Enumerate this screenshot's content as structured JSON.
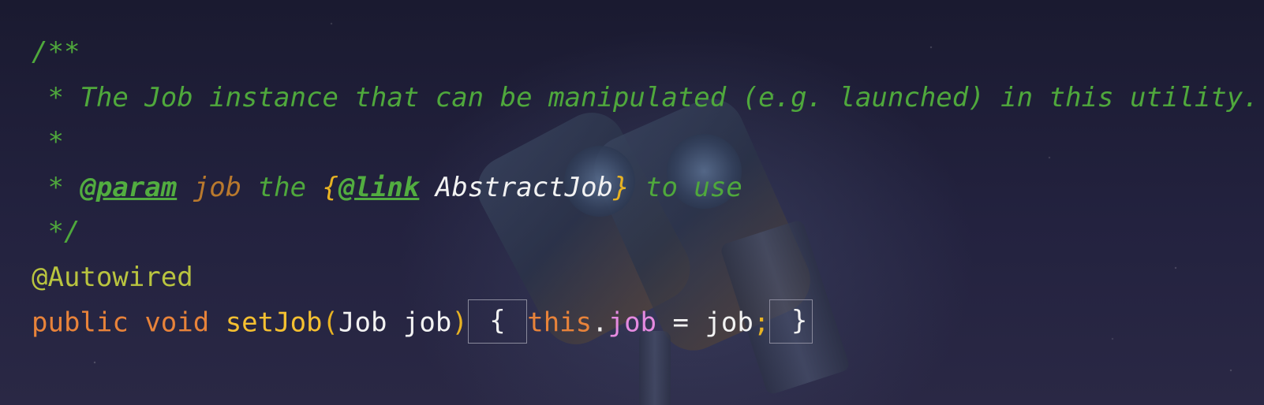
{
  "javadoc": {
    "open": "/**",
    "summary": " * The Job instance that can be manipulated (e.g. launched) in this utility.",
    "blank": " *",
    "param_prefix": " * ",
    "param_tag": "@param",
    "param_space": " ",
    "param_name": "job",
    "param_the": " the ",
    "link_open": "{",
    "link_tag": "@link",
    "link_space": " ",
    "link_target": "AbstractJob",
    "link_close": "}",
    "param_rest": " to use",
    "close": " */"
  },
  "annotation": "@Autowired",
  "method_line": {
    "kw_public": "public",
    "kw_void": "void",
    "method_name": "setJob",
    "paren_open": "(",
    "param_type": "Job",
    "param_name": "job",
    "paren_close": ")",
    "fold_open": " { ",
    "kw_this": "this",
    "dot": ".",
    "field": "job",
    "assign": " = ",
    "value": "job",
    "semi": ";",
    "fold_close": " }"
  },
  "colors": {
    "comment": "#4fa83c",
    "keyword": "#e8833a",
    "method": "#f5c031",
    "annotation": "#b9c43f",
    "field": "#e58ae0",
    "param_ref": "#b9792d"
  }
}
